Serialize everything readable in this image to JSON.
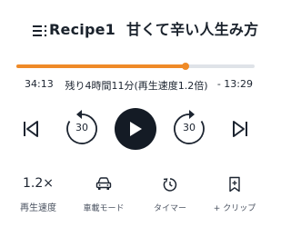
{
  "episode": {
    "number_label": "Recipe1",
    "title": "甘くて辛い人生み方"
  },
  "playback": {
    "progress": 0.71,
    "elapsed": "34:13",
    "remaining_text": "残り4時間11分(再生速度1.2倍)",
    "remaining": "- 13:29"
  },
  "controls": {
    "rewind_seconds": "30",
    "forward_seconds": "30"
  },
  "bottom_bar": {
    "speed_value": "1.2×",
    "speed_label": "再生速度",
    "car_mode_label": "車載モード",
    "timer_label": "タイマー",
    "clip_label": "+ クリップ"
  },
  "colors": {
    "accent": "#ef8a27",
    "track": "#dfe3e8",
    "play_button": "#141b25"
  },
  "icons": [
    "menu-list-icon",
    "skip-previous-icon",
    "rewind-30-icon",
    "play-icon",
    "forward-30-icon",
    "skip-next-icon",
    "car-icon",
    "timer-icon",
    "bookmark-icon"
  ]
}
